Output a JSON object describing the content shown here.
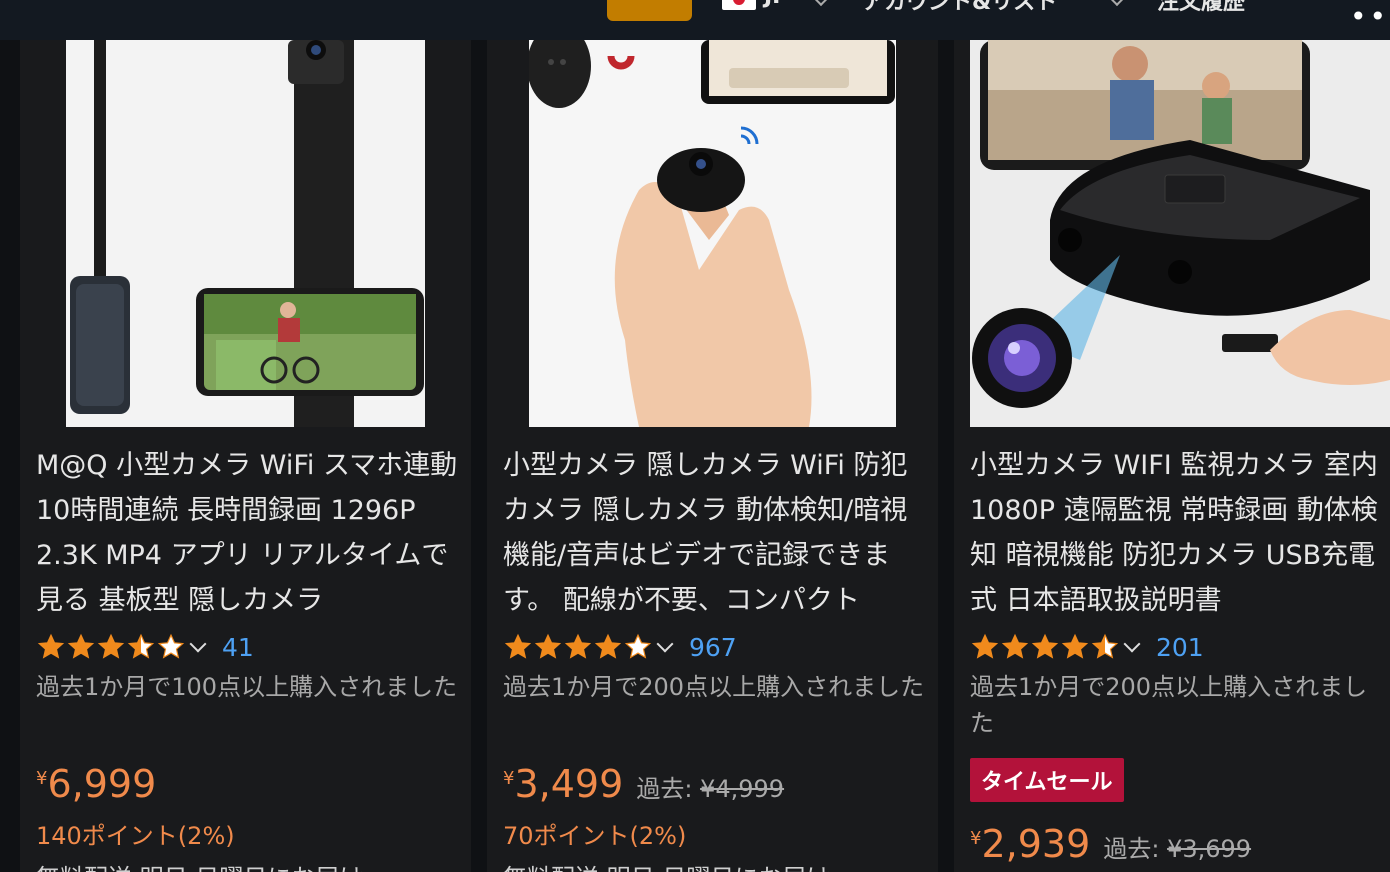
{
  "header": {
    "nav_lang": "JP",
    "nav_account": "アカウント&リスト",
    "nav_orders": "注文履歴"
  },
  "colors": {
    "price": "#f08a4b",
    "link": "#4ea1f3",
    "star": "#f08a1c",
    "timesale": "#b3123a"
  },
  "products": [
    {
      "title": "M@Q 小型カメラ WiFi スマホ連動 10時間連続 長時間録画 1296P 2.3K MP4 アプリ リアルタイムで見る 基板型 隠しカメラ",
      "rating": 3.5,
      "rating_count": "41",
      "bought": "過去1か月で100点以上購入されました",
      "currency": "¥",
      "price": "6,999",
      "points": "140ポイント(2%)",
      "shipping": "無料配送 明日 日曜日にお届け"
    },
    {
      "title": "小型カメラ 隠しカメラ WiFi 防犯カメラ 隠しカメラ 動体検知/暗視機能/音声はビデオで記録できます。 配線が不要、コンパクト",
      "rating": 4.0,
      "rating_count": "967",
      "bought": "過去1か月で200点以上購入されました",
      "currency": "¥",
      "price": "3,499",
      "past_label": "過去:",
      "past_price": "¥4,999",
      "points": "70ポイント(2%)",
      "shipping": "無料配送 明日 日曜日にお届け"
    },
    {
      "title": "小型カメラ WIFI 監視カメラ 室内 1080P 遠隔監視 常時録画 動体検知 暗視機能 防犯カメラ USB充電式 日本語取扱説明書",
      "rating": 4.5,
      "rating_count": "201",
      "bought": "過去1か月で200点以上購入されました",
      "badge": "タイムセール",
      "currency": "¥",
      "price": "2,939",
      "past_label": "過去:",
      "past_price": "¥3,699"
    }
  ]
}
